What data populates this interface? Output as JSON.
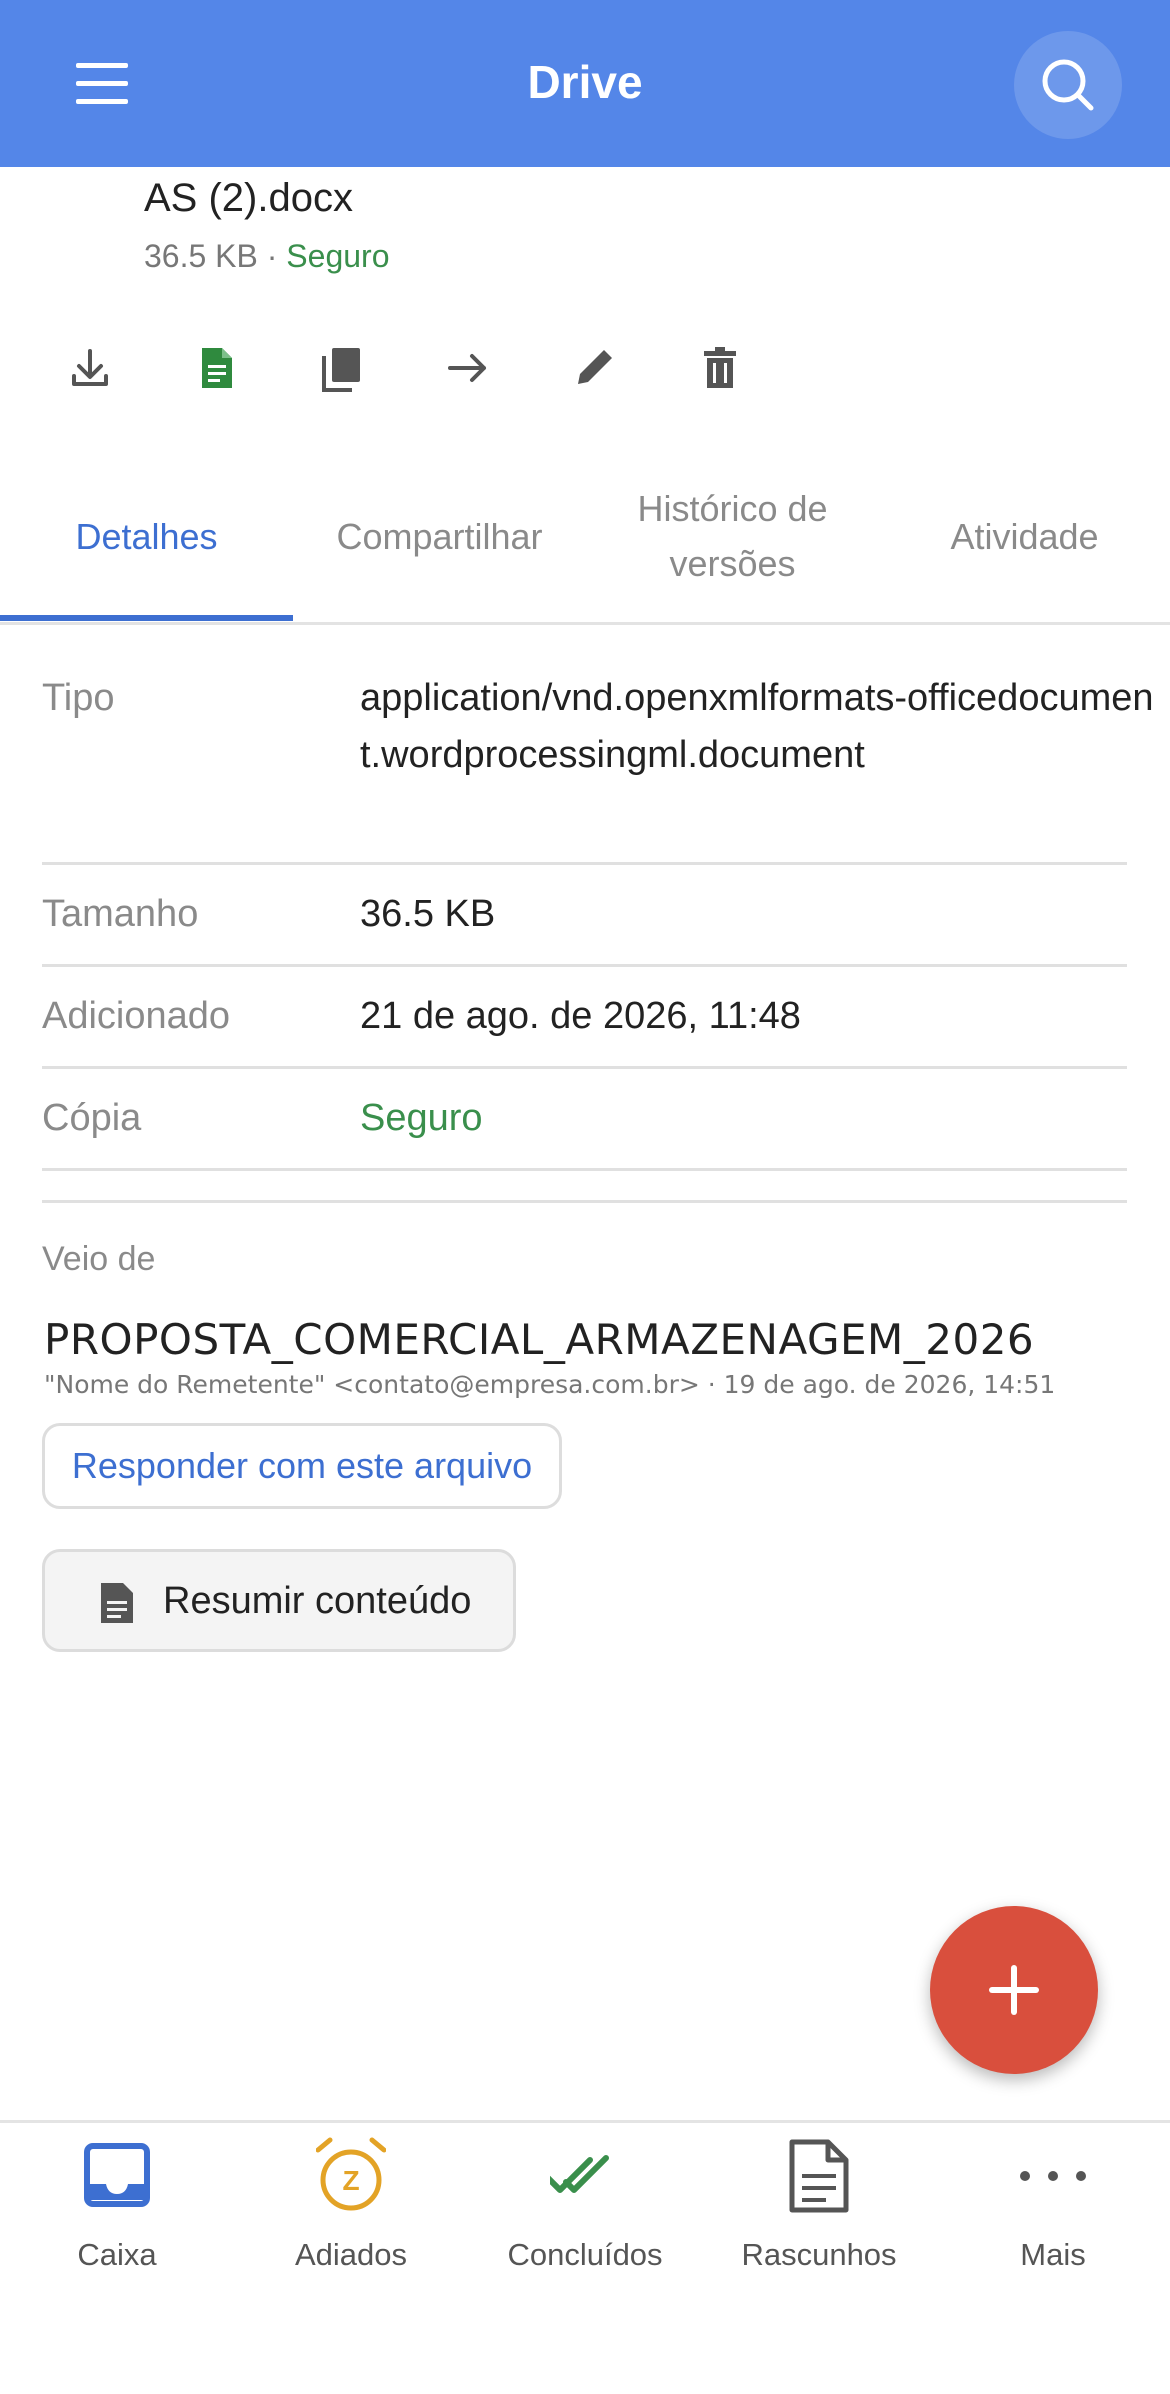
{
  "header": {
    "title": "Drive",
    "menu_icon": "hamburger-menu-icon",
    "search_icon": "search-icon",
    "color": "#5486e8"
  },
  "file": {
    "name": "AS (2).docx",
    "size": "36.5 KB",
    "separator": " · ",
    "status": "Seguro"
  },
  "actions": [
    {
      "icon": "download-icon"
    },
    {
      "icon": "document-icon"
    },
    {
      "icon": "copy-icon"
    },
    {
      "icon": "forward-arrow-icon"
    },
    {
      "icon": "pencil-icon"
    },
    {
      "icon": "trash-icon"
    }
  ],
  "tabs": [
    {
      "label": "Detalhes",
      "active": true
    },
    {
      "label": "Compartilhar"
    },
    {
      "label_line1": "Histórico de",
      "label_line2": "versões"
    },
    {
      "label": "Atividade"
    }
  ],
  "details": [
    {
      "label": "Tipo",
      "value": "application/vnd.openxmlformats-officedocument.wordprocessingml.document"
    },
    {
      "label": "Tamanho",
      "value": "36.5 KB"
    },
    {
      "label": "Adicionado",
      "value": "21 de ago. de 2026, 11:48"
    },
    {
      "label": "Cópia",
      "value": "Seguro"
    }
  ],
  "source": {
    "label": "Veio de",
    "subject": "PROPOSTA_COMERCIAL_ARMAZENAGEM_2026",
    "meta": "\"Nome do Remetente\" <contato@empresa.com.br> · 19 de ago. de 2026, 14:51",
    "reply_label": "Responder com este arquivo",
    "summary_label": "Resumir conteúdo"
  },
  "fab": {
    "icon": "plus-icon",
    "color": "#d94f3d"
  },
  "bottom_nav": [
    {
      "label": "Caixa",
      "icon": "inbox-icon"
    },
    {
      "label": "Adiados",
      "icon": "snooze-clock-icon"
    },
    {
      "label": "Concluídos",
      "icon": "double-check-icon"
    },
    {
      "label": "Rascunhos",
      "icon": "draft-document-icon"
    },
    {
      "label": "Mais",
      "icon": "more-dots-icon"
    }
  ],
  "colors": {
    "accent": "#3d6fd1",
    "safe": "#3a8f4c"
  }
}
